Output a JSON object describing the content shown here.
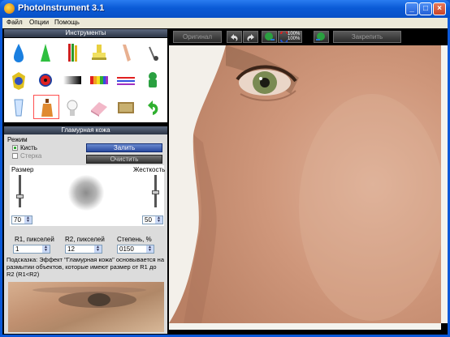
{
  "window": {
    "title": "PhotoInstrument 3.1",
    "minimize_glyph": "_",
    "maximize_glyph": "□",
    "close_glyph": "×"
  },
  "menu": {
    "file": "Файл",
    "options": "Опции",
    "help": "Помощь"
  },
  "tools_panel": {
    "title": "Инструменты",
    "tools": [
      "drop-icon",
      "cone-icon",
      "pencils-icon",
      "stamp-icon",
      "eraser-stick-icon",
      "pin-icon",
      "badge-icon",
      "eye-icon",
      "gradient-icon",
      "rainbow-icon",
      "lines-icon",
      "sponge-icon",
      "glass-icon",
      "bottle-icon",
      "bulb-icon",
      "eraser-icon",
      "texture-icon",
      "undo-arrow-icon"
    ],
    "selected_index": 13
  },
  "glamour_panel": {
    "title": "Гламурная кожа",
    "mode_label": "Режим",
    "brush_label": "Кисть",
    "eraser_label": "Стерка",
    "brush_checked": true,
    "eraser_checked": false,
    "fill_button": "Залить",
    "clear_button": "Очистить",
    "size_label": "Размер",
    "hardness_label": "Жесткость",
    "size_value": "70",
    "hardness_value": "50",
    "r1_label": "R1, пикселей",
    "r2_label": "R2, пикселей",
    "degree_label": "Степень, %",
    "r1_value": "1",
    "r2_value": "12",
    "degree_value": "0150",
    "hint": "Подсказка: Эффект \"Гламурная кожа\" основывается на размытии объектов, которые имеют размер от R1 до R2 (R1<R2)"
  },
  "toolbar": {
    "original_button": "Оригинал",
    "zoom_label_top": "100%",
    "zoom_label_bottom": "100%",
    "commit_button": "Закрепить"
  },
  "colors": {
    "title_blue": "#0a5ad6",
    "panel_dark": "#000000",
    "accent_red": "#ff5050"
  }
}
